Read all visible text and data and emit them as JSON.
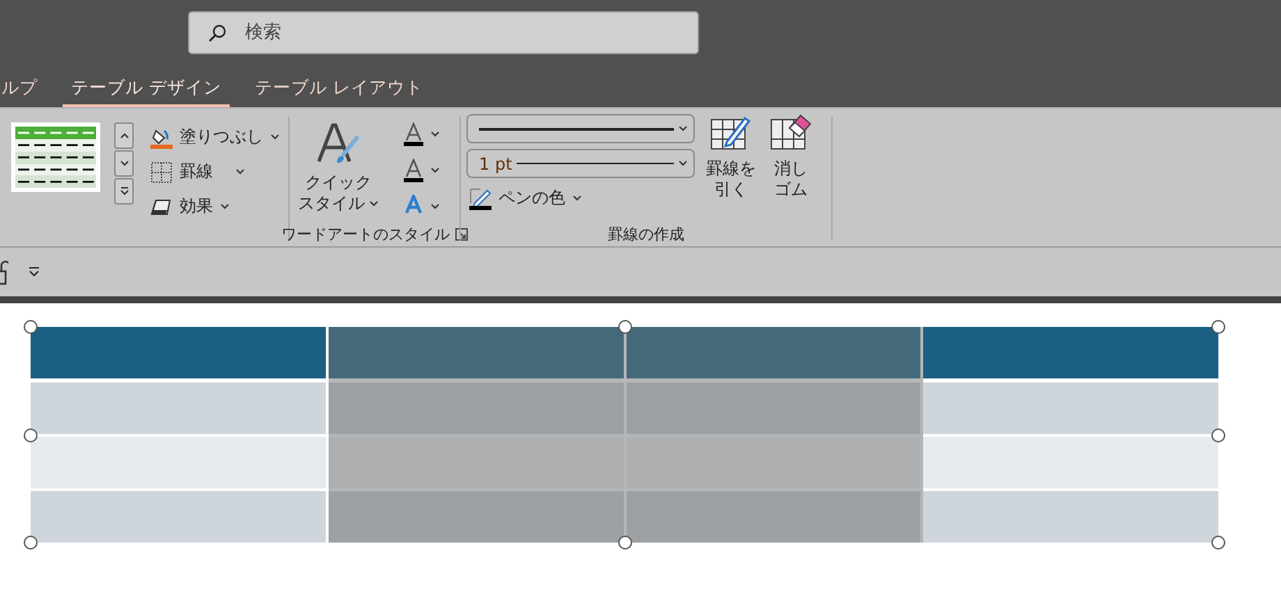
{
  "search": {
    "placeholder": "検索"
  },
  "tabs": [
    {
      "label": "ルプ",
      "selected": false
    },
    {
      "label": "テーブル デザイン",
      "selected": true
    },
    {
      "label": "テーブル レイアウト",
      "selected": false
    }
  ],
  "ribbon": {
    "shading": "塗りつぶし",
    "borders": "罫線",
    "effects": "効果",
    "quick_style": [
      "クイック",
      "スタイル"
    ],
    "wordart_label": "ワードアートのスタイル",
    "pen_weight": "1 pt",
    "pen_color": "ペンの色",
    "draw_table": [
      "罫線を",
      "引く"
    ],
    "eraser": [
      "消し",
      "ゴム"
    ],
    "draw_borders_label": "罫線の作成"
  },
  "table": {
    "columns": [
      {
        "selected": false
      },
      {
        "selected": true
      },
      {
        "selected": true
      },
      {
        "selected": false
      }
    ],
    "rows": [
      {
        "banded": true
      },
      {
        "banded": false
      },
      {
        "banded": true
      }
    ]
  }
}
